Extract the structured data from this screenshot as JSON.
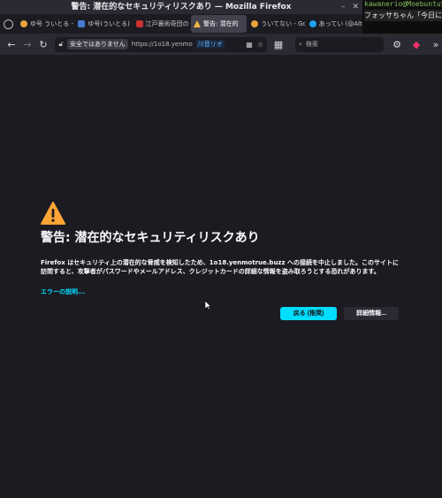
{
  "window": {
    "title": "警告: 潜在的なセキュリティリスクあり — Mozilla Firefox"
  },
  "terminal": {
    "prompt": "kawanerio@MoebuntuStu",
    "text": "フォッサちゃん「今日に"
  },
  "tabs": [
    {
      "label": "ゆ号 ういとる - G",
      "fav_color": "#e8a33d",
      "active": false
    },
    {
      "label": "ゆ号(ういとる) (J",
      "fav_color": "#4a7bd0",
      "active": false
    },
    {
      "label": "江戸裏術奇団の",
      "fav_color": "#cc3333",
      "active": false
    },
    {
      "label": "警告: 潜在的",
      "fav_color": "#f5b642",
      "active": true
    },
    {
      "label": "ういてない - Go",
      "fav_color": "#e8a33d",
      "active": false
    },
    {
      "label": "あってい (@Alt",
      "fav_color": "#1da1f2",
      "active": false
    }
  ],
  "navbar": {
    "secure_label": "安全ではありません",
    "url": "https://1o18.yenmo",
    "badge": "川音リオ",
    "search_placeholder": "検索"
  },
  "page": {
    "heading": "警告: 潜在的なセキュリティリスクあり",
    "description": "Firefox はセキュリティ上の潜在的な脅威を検知したため、1o18.yenmotrue.buzz への接続を中止しました。このサイトに訪問すると、攻撃者がパスワードやメールアドレス、クレジットカードの詳細な情報を盗み取ろうとする恐れがあります。",
    "learn_more": "エラーの説明...",
    "back_button": "戻る (推奨)",
    "advanced_button": "詳細情報..."
  },
  "colors": {
    "accent": "#00ddff",
    "warning": "#ffa436",
    "background": "#1c1b22"
  }
}
